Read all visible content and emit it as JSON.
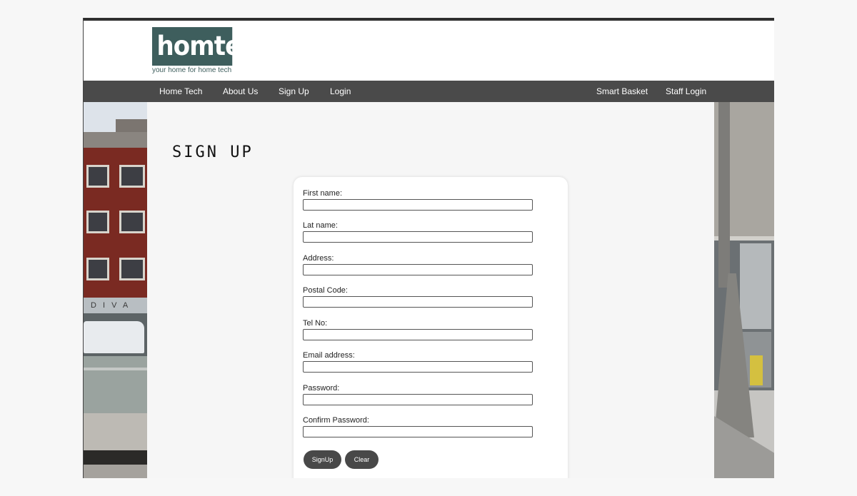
{
  "brand": {
    "logo_text": "homteq`",
    "tagline": "your home for home tech",
    "color": "#3e5e5d"
  },
  "nav": {
    "left": [
      {
        "label": "Home Tech"
      },
      {
        "label": "About Us"
      },
      {
        "label": "Sign Up"
      },
      {
        "label": "Login"
      }
    ],
    "right": [
      {
        "label": "Smart Basket"
      },
      {
        "label": "Staff Login"
      }
    ]
  },
  "page": {
    "title": "SIGN UP"
  },
  "form": {
    "fields": [
      {
        "label": "First name:",
        "value": ""
      },
      {
        "label": "Lat name:",
        "value": ""
      },
      {
        "label": "Address:",
        "value": ""
      },
      {
        "label": "Postal Code:",
        "value": ""
      },
      {
        "label": "Tel No:",
        "value": ""
      },
      {
        "label": "Email address:",
        "value": ""
      },
      {
        "label": "Password:",
        "value": ""
      },
      {
        "label": "Confirm Password:",
        "value": ""
      }
    ],
    "signup_label": "SignUp",
    "clear_label": "Clear"
  },
  "photo": {
    "shop_sign": "D I V A"
  },
  "colors": {
    "nav_bg": "#4a4a4a",
    "button_bg": "#484848",
    "page_bg": "#f6f6f6"
  }
}
